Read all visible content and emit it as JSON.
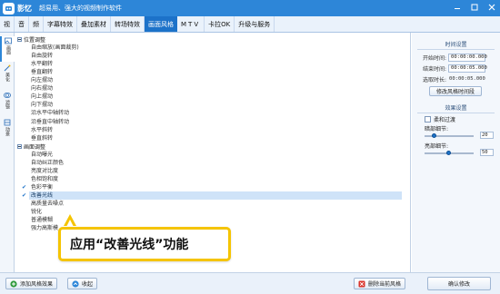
{
  "app": {
    "name": "影忆",
    "slogan": "超易用、强大的视频制作软件"
  },
  "menu": {
    "tabs": [
      "视",
      "音",
      "频",
      "字幕特效",
      "叠加素材",
      "转场特效",
      "画面风格",
      "MTV",
      "卡拉OK",
      "升级与服务"
    ],
    "active_index": 6
  },
  "sidebar": {
    "items": [
      {
        "label": "画面",
        "icon": "picture-icon",
        "active": true
      },
      {
        "label": "美化",
        "icon": "beautify-icon",
        "active": false
      },
      {
        "label": "滤镜",
        "icon": "filter-icon",
        "active": false
      },
      {
        "label": "动景",
        "icon": "motion-icon",
        "active": false
      }
    ]
  },
  "list": {
    "groups": [
      {
        "title": "位置调整",
        "items": [
          {
            "label": "自由缩放(画面裁剪)",
            "checked": false,
            "selected": false
          },
          {
            "label": "自由旋转",
            "checked": false,
            "selected": false
          },
          {
            "label": "水平翻转",
            "checked": false,
            "selected": false
          },
          {
            "label": "垂直翻转",
            "checked": false,
            "selected": false
          },
          {
            "label": "向左摆动",
            "checked": false,
            "selected": false
          },
          {
            "label": "向右摆动",
            "checked": false,
            "selected": false
          },
          {
            "label": "向上摆动",
            "checked": false,
            "selected": false
          },
          {
            "label": "向下摆动",
            "checked": false,
            "selected": false
          },
          {
            "label": "沿水平中轴转动",
            "checked": false,
            "selected": false
          },
          {
            "label": "沿垂直中轴转动",
            "checked": false,
            "selected": false
          },
          {
            "label": "水平斜转",
            "checked": false,
            "selected": false
          },
          {
            "label": "垂直斜转",
            "checked": false,
            "selected": false
          }
        ]
      },
      {
        "title": "画面调整",
        "items": [
          {
            "label": "自动曝光",
            "checked": false,
            "selected": false
          },
          {
            "label": "自动纠正颜色",
            "checked": false,
            "selected": false
          },
          {
            "label": "亮度对比度",
            "checked": false,
            "selected": false
          },
          {
            "label": "色相饱和度",
            "checked": false,
            "selected": false
          },
          {
            "label": "色彩平衡",
            "checked": true,
            "selected": false
          },
          {
            "label": "改善光线",
            "checked": true,
            "selected": true
          },
          {
            "label": "高质量去噪点",
            "checked": false,
            "selected": false
          },
          {
            "label": "锐化",
            "checked": false,
            "selected": false
          },
          {
            "label": "普通模糊",
            "checked": false,
            "selected": false
          },
          {
            "label": "强力高斯模",
            "checked": false,
            "selected": false
          }
        ]
      }
    ]
  },
  "callout": {
    "text": "应用“改善光线”功能"
  },
  "right_panel": {
    "time_section_title": "时间设置",
    "start_label": "开始时间:",
    "start_value": "00:00:00.000",
    "end_label": "结束时间:",
    "end_value": "00:00:05.000",
    "duration_label": "选取时长:",
    "duration_value": "00:00:05.000",
    "modify_time_button": "修改风格时间段",
    "effect_section_title": "效果设置",
    "soft_transition_label": "柔和过渡",
    "soft_transition_checked": false,
    "dark_label": "暗部细节:",
    "dark_value": "20",
    "dark_level": 0.2,
    "bright_label": "亮部细节:",
    "bright_value": "50",
    "bright_level": 0.5,
    "confirm_button": "确认修改"
  },
  "bottom": {
    "add_style_button": "添加风格效果",
    "collapse_button": "收起",
    "delete_style_button": "删除当前风格"
  },
  "colors": {
    "title_bar": "#2d86d8",
    "accent": "#1e73c8",
    "callout_border": "#f5c400",
    "selected_row": "#cfe3f8",
    "delete_icon": "#d9342b",
    "add_icon": "#2f9a3c"
  }
}
